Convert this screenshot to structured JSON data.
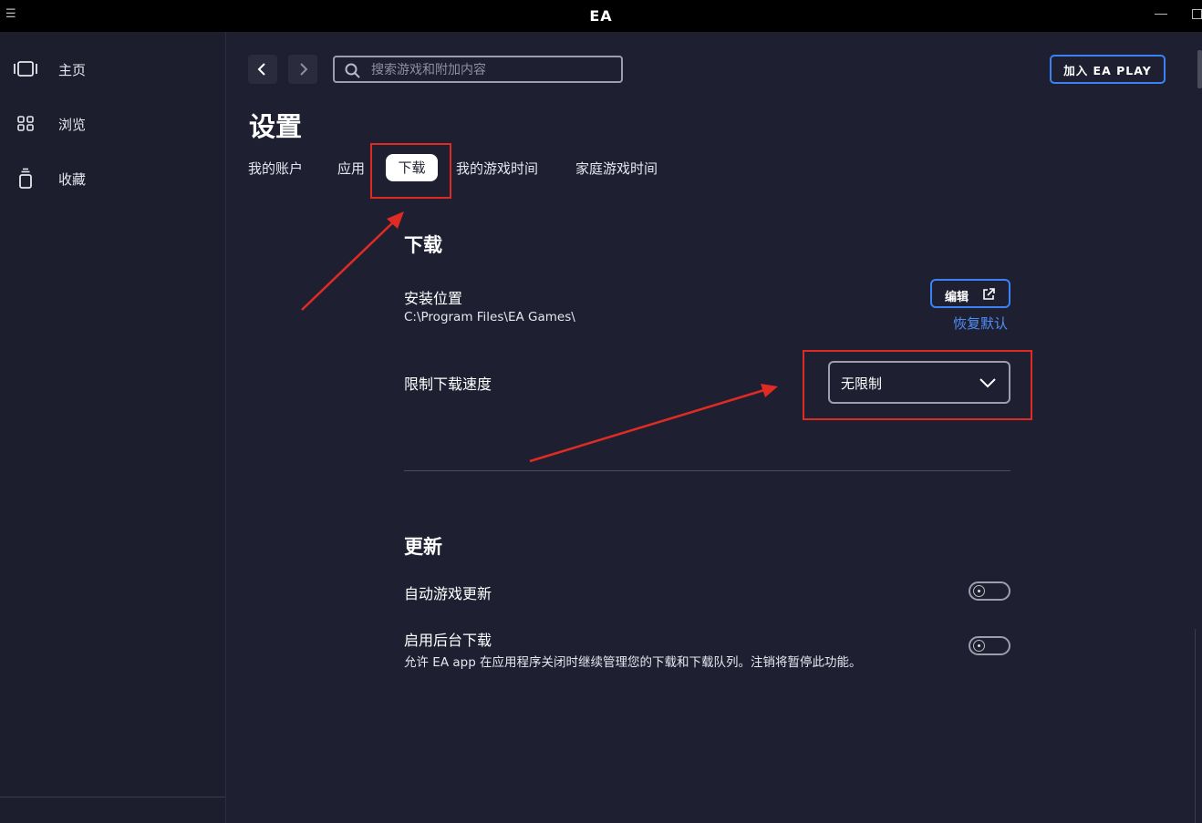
{
  "titlebar": {
    "logo": "EA",
    "menu_icon": "hamburger-icon",
    "minimize_icon": "minimize-icon",
    "maximize_icon": "maximize-icon"
  },
  "sidebar": {
    "items": [
      {
        "label": "主页",
        "icon": "carousel-icon"
      },
      {
        "label": "浏览",
        "icon": "grid-icon"
      },
      {
        "label": "收藏",
        "icon": "collection-icon"
      }
    ]
  },
  "topbar": {
    "back_icon": "chevron-left-icon",
    "forward_icon": "chevron-right-icon",
    "search_placeholder": "搜索游戏和附加内容",
    "search_value": "",
    "ea_play_label": "加入 EA PLAY"
  },
  "page": {
    "title": "设置",
    "tabs": [
      {
        "label": "我的账户"
      },
      {
        "label": "应用"
      },
      {
        "label": "下载",
        "active": true
      },
      {
        "label": "我的游戏时间"
      },
      {
        "label": "家庭游戏时间"
      }
    ]
  },
  "download_section": {
    "title": "下载",
    "install_location_label": "安装位置",
    "install_location_value": "C:\\Program Files\\EA Games\\",
    "edit_label": "编辑",
    "restore_default_label": "恢复默认",
    "speed_limit_label": "限制下载速度",
    "speed_limit_value": "无限制"
  },
  "update_section": {
    "title": "更新",
    "auto_update_label": "自动游戏更新",
    "auto_update_on": false,
    "background_download_label": "启用后台下载",
    "background_download_desc": "允许 EA app 在应用程序关闭时继续管理您的下载和下载队列。注销将暂停此功能。",
    "background_download_on": false
  },
  "colors": {
    "accent": "#3b82f6",
    "annotation": "#e02b24",
    "background": "#1e2032",
    "sidebar": "#1c1d2d"
  }
}
